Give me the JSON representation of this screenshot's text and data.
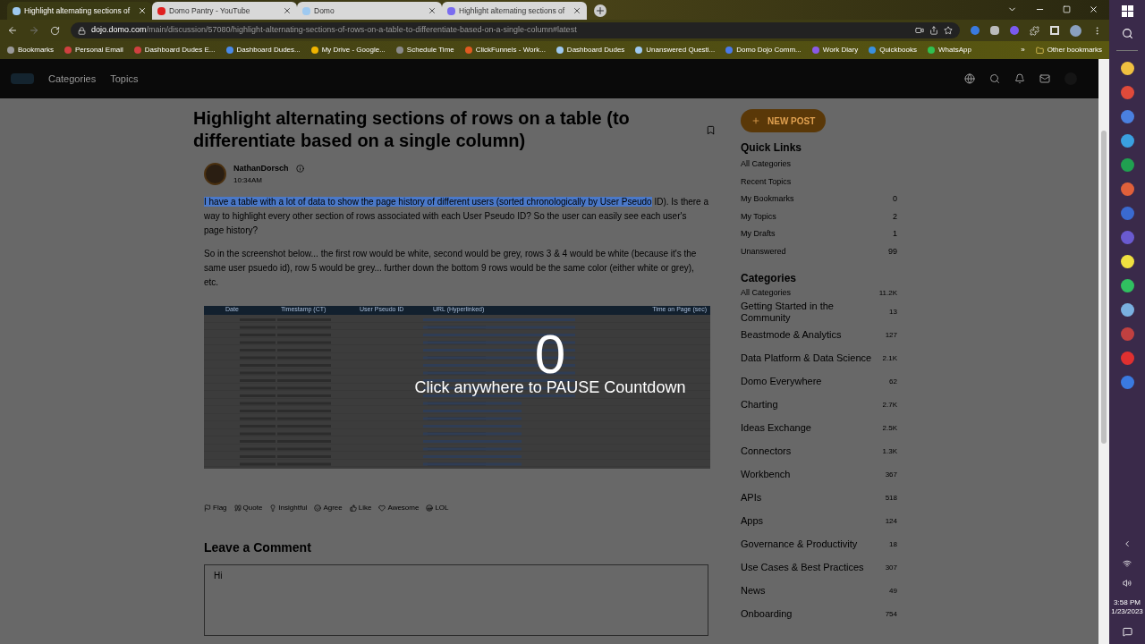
{
  "browser": {
    "tabs": [
      {
        "title": "Highlight alternating sections of",
        "selected": true
      },
      {
        "title": "Domo Pantry - YouTube",
        "selected": false
      },
      {
        "title": "Domo",
        "selected": false
      },
      {
        "title": "Highlight alternating sections of",
        "selected": false
      }
    ],
    "url": {
      "host": "dojo.domo.com",
      "path": "/main/discussion/57080/highlight-alternating-sections-of-rows-on-a-table-to-differentiate-based-on-a-single-column#latest"
    },
    "bookmarks": [
      {
        "label": "Bookmarks",
        "color": "#9a9a9a"
      },
      {
        "label": "Personal Email",
        "color": "#d04040"
      },
      {
        "label": "Dashboard Dudes E...",
        "color": "#d04040"
      },
      {
        "label": "Dashboard Dudes...",
        "color": "#4a8ae8"
      },
      {
        "label": "My Drive - Google...",
        "color": "#f0b400"
      },
      {
        "label": "Schedule Time",
        "color": "#8a8a8a"
      },
      {
        "label": "ClickFunnels - Work...",
        "color": "#e05a20"
      },
      {
        "label": "Dashboard Dudes",
        "color": "#9ec9f0"
      },
      {
        "label": "Unanswered Questi...",
        "color": "#9ec9f0"
      },
      {
        "label": "Domo Dojo Comm...",
        "color": "#4a7ae8"
      },
      {
        "label": "Work Diary",
        "color": "#8a5ae8"
      },
      {
        "label": "Quickbooks",
        "color": "#3a90e0"
      },
      {
        "label": "WhatsApp",
        "color": "#30c050"
      }
    ],
    "more": "»",
    "other_bookmarks": "Other bookmarks"
  },
  "site": {
    "nav": [
      "Categories",
      "Topics"
    ]
  },
  "post": {
    "title": "Highlight alternating sections of rows on a table (to differentiate based on a single column)",
    "author": "NathanDorsch",
    "time": "10:34AM",
    "paragraphs": [
      [
        {
          "text": "I have a table with a lot of data to show the page history of different users (sorted chronologically by User Pseudo",
          "selected": true
        },
        {
          "text": " ID). Is there a way to highlight every other section of rows associated with each User Pseudo ID? So the user can easily see each user's page history?",
          "selected": false
        }
      ],
      [
        {
          "text": "So in the screenshot below... the first row would be white, second would be grey, rows 3 & 4 would be white (because it's the same user psuedo id), row 5 would be grey... further down the bottom 9 rows would be the same color (either white or grey), etc.",
          "selected": false
        }
      ]
    ],
    "table_columns": [
      "Date",
      "Timestamp (CT)",
      "User Pseudo ID",
      "URL (Hyperlinked)",
      "Time on Page (sec)"
    ],
    "reactions": [
      "Flag",
      "Quote",
      "Insightful",
      "Agree",
      "Like",
      "Awesome",
      "LOL"
    ],
    "comment_heading": "Leave a Comment",
    "comment_value": "Hi"
  },
  "sidebar": {
    "new_post": "NEW POST",
    "quick_links_title": "Quick Links",
    "quick_links": [
      {
        "label": "All Categories"
      },
      {
        "label": "Recent Topics"
      },
      {
        "label": "My Bookmarks",
        "count": "0"
      },
      {
        "label": "My Topics",
        "count": "2"
      },
      {
        "label": "My Drafts",
        "count": "1"
      },
      {
        "label": "Unanswered",
        "count": "99"
      }
    ],
    "categories_title": "Categories",
    "categories": [
      {
        "label": "All Categories",
        "count": "11.2K",
        "kind": "small"
      },
      {
        "label": "Getting Started in the Community",
        "count": "13",
        "kind": "large"
      },
      {
        "label": "Beastmode & Analytics",
        "count": "127",
        "kind": "large"
      },
      {
        "label": "Data Platform & Data Science",
        "count": "2.1K",
        "kind": "large"
      },
      {
        "label": "Domo Everywhere",
        "count": "62",
        "kind": "large"
      },
      {
        "label": "Charting",
        "count": "2.7K",
        "kind": "large"
      },
      {
        "label": "Ideas Exchange",
        "count": "2.5K",
        "kind": "large"
      },
      {
        "label": "Connectors",
        "count": "1.3K",
        "kind": "large"
      },
      {
        "label": "Workbench",
        "count": "367",
        "kind": "large"
      },
      {
        "label": "APIs",
        "count": "518",
        "kind": "large"
      },
      {
        "label": "Apps",
        "count": "124",
        "kind": "large"
      },
      {
        "label": "Governance & Productivity",
        "count": "18",
        "kind": "large"
      },
      {
        "label": "Use Cases & Best Practices",
        "count": "307",
        "kind": "large"
      },
      {
        "label": "News",
        "count": "49",
        "kind": "large"
      },
      {
        "label": "Onboarding",
        "count": "754",
        "kind": "large"
      }
    ]
  },
  "overlay": {
    "count": "0",
    "message": "Click anywhere to PAUSE Countdown"
  },
  "taskbar": {
    "apps": [
      {
        "color": "#f0c040"
      },
      {
        "color": "#e04a3a"
      },
      {
        "color": "#4a80e0"
      },
      {
        "color": "#3aa0e0"
      },
      {
        "color": "#20a050"
      },
      {
        "color": "#e0603a"
      },
      {
        "color": "#3a6ad0"
      },
      {
        "color": "#6a5ad0"
      },
      {
        "color": "#f0e040"
      },
      {
        "color": "#30c060"
      },
      {
        "color": "#7ab0e0"
      },
      {
        "color": "#c04040"
      },
      {
        "color": "#e03030"
      },
      {
        "color": "#3a7ae0"
      }
    ],
    "time": "3:58 PM",
    "date": "1/23/2023"
  }
}
